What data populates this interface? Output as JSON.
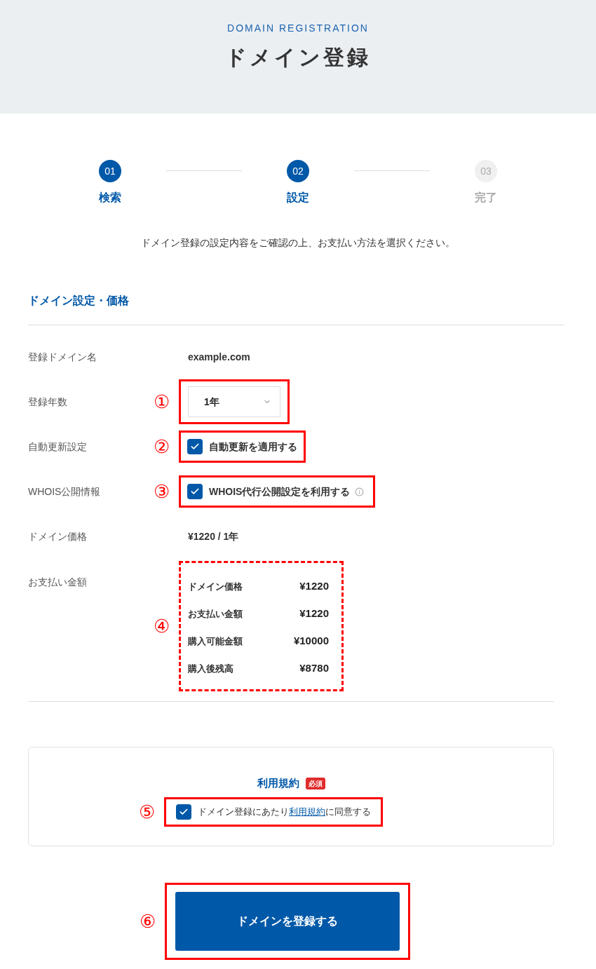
{
  "header": {
    "eyebrow": "DOMAIN REGISTRATION",
    "title": "ドメイン登録"
  },
  "steps": [
    {
      "number": "01",
      "label": "検索",
      "active": true
    },
    {
      "number": "02",
      "label": "設定",
      "active": true
    },
    {
      "number": "03",
      "label": "完了",
      "active": false
    }
  ],
  "instruction": "ドメイン登録の設定内容をご確認の上、お支払い方法を選択ください。",
  "section_title": "ドメイン設定・価格",
  "rows": [
    {
      "kind": "text",
      "label": "登録ドメイン名",
      "value": "example.com"
    },
    {
      "kind": "select",
      "label": "登録年数",
      "annotation": "①",
      "annotation_dashed": false,
      "value": "1年"
    },
    {
      "kind": "checkbox",
      "label": "自動更新設定",
      "annotation": "②",
      "annotation_dashed": false,
      "text": "自動更新を適用する",
      "checked": true,
      "info": false
    },
    {
      "kind": "checkbox",
      "label": "WHOIS公開情報",
      "annotation": "③",
      "annotation_dashed": false,
      "text": "WHOIS代行公開設定を利用する",
      "checked": true,
      "info": true
    },
    {
      "kind": "text",
      "label": "ドメイン価格",
      "value": "¥1220 / 1年"
    },
    {
      "kind": "price_table",
      "label": "お支払い金額",
      "annotation": "④",
      "annotation_dashed": true,
      "items": [
        {
          "name": "ドメイン価格",
          "amount": "¥1220"
        },
        {
          "name": "お支払い金額",
          "amount": "¥1220"
        },
        {
          "name": "購入可能金額",
          "amount": "¥10000"
        },
        {
          "name": "購入後残高",
          "amount": "¥8780"
        }
      ]
    }
  ],
  "terms": {
    "title": "利用規約",
    "badge": "必須",
    "annotation": "⑤",
    "checked": true,
    "text_before": "ドメイン登録にあたり",
    "link": "利用規約",
    "text_after": "に同意する"
  },
  "submit": {
    "annotation": "⑥",
    "label": "ドメインを登録する"
  }
}
